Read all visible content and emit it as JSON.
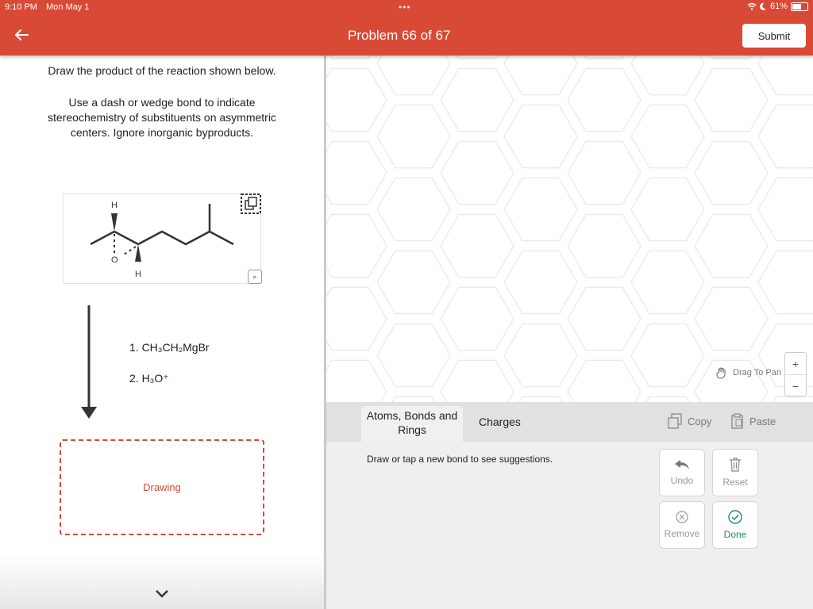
{
  "status_bar": {
    "time": "9:10 PM",
    "date": "Mon May 1",
    "battery": "61%",
    "battery_level": 0.61
  },
  "header": {
    "title": "Problem 66 of 67",
    "submit_label": "Submit",
    "accent": "#d84a36"
  },
  "left_panel": {
    "instruction_1": "Draw the product of the reaction shown below.",
    "instruction_2": "Use a dash or wedge bond to indicate stereochemistry of substituents on asymmetric centers. Ignore inorganic byproducts.",
    "molecule_atoms": {
      "h_top": "H",
      "o": "O",
      "h_bottom": "H"
    },
    "reagent_1": "1. CH₃CH₂MgBr",
    "reagent_2": "2. H₃O⁺",
    "drawing_label": "Drawing"
  },
  "canvas": {
    "drag_label": "Drag To Pan",
    "zoom_in": "+",
    "zoom_out": "−"
  },
  "toolbar": {
    "tab_atoms": "Atoms, Bonds and Rings",
    "tab_charges": "Charges",
    "copy_label": "Copy",
    "paste_label": "Paste"
  },
  "bottom_panel": {
    "hint": "Draw or tap a new bond to see suggestions.",
    "undo_label": "Undo",
    "reset_label": "Reset",
    "remove_label": "Remove",
    "done_label": "Done",
    "done_color": "#1b8a7a"
  }
}
